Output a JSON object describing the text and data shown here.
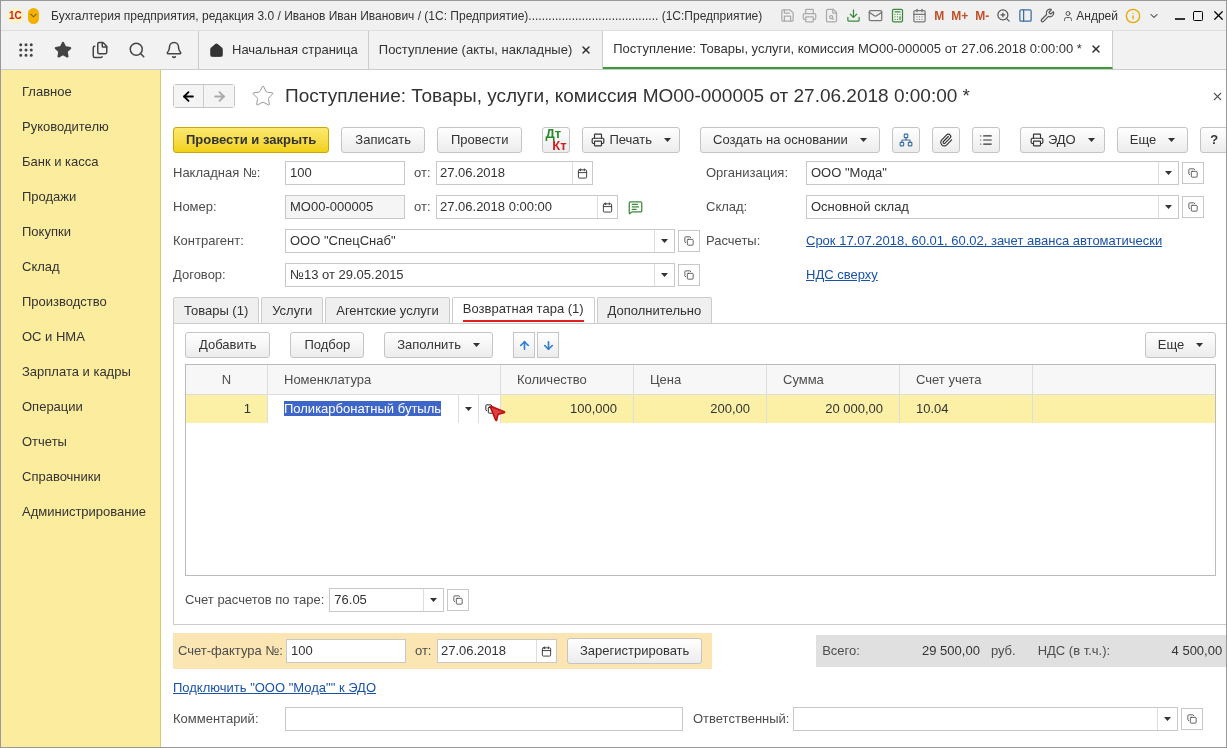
{
  "window": {
    "logo": "1С",
    "title": "Бухгалтерия предприятия, редакция 3.0 / Иванов Иван Иванович / (1С: Предприятие)....................................... (1С:Предприятие)",
    "memory_buttons": [
      "M",
      "M+",
      "M-"
    ],
    "user": "Андрей"
  },
  "tabs": [
    {
      "kind": "home",
      "label": "Начальная страница",
      "selected": false
    },
    {
      "kind": "doc",
      "label": "Поступление (акты, накладные)",
      "selected": false
    },
    {
      "kind": "doc",
      "label": "Поступление: Товары, услуги, комиссия МО00-000005 от 27.06.2018 0:00:00 *",
      "selected": true
    }
  ],
  "sidebar": {
    "items": [
      "Главное",
      "Руководителю",
      "Банк и касса",
      "Продажи",
      "Покупки",
      "Склад",
      "Производство",
      "ОС и НМА",
      "Зарплата и кадры",
      "Операции",
      "Отчеты",
      "Справочники",
      "Администрирование"
    ]
  },
  "form": {
    "title": "Поступление: Товары, услуги, комиссия МО00-000005 от 27.06.2018 0:00:00 *",
    "commands": [
      {
        "kind": "primary",
        "label": "Провести и закрыть"
      },
      {
        "kind": "plain",
        "label": "Записать"
      },
      {
        "kind": "plain",
        "label": "Провести"
      },
      {
        "kind": "dtkt",
        "label": "Дт",
        "label2": "Кт"
      },
      {
        "kind": "print",
        "label": "Печать"
      },
      {
        "kind": "menu",
        "label": "Создать на основании"
      },
      {
        "kind": "structure"
      },
      {
        "kind": "clip"
      },
      {
        "kind": "list"
      },
      {
        "kind": "edo",
        "label": "ЭДО"
      },
      {
        "kind": "menu",
        "label": "Еще"
      },
      {
        "kind": "help",
        "label": "?"
      }
    ],
    "invoice_no": {
      "label": "Накладная  №:",
      "value": "100",
      "date_label": "от:",
      "date": "27.06.2018"
    },
    "number": {
      "label": "Номер:",
      "value": "МО00-000005",
      "date_label": "от:",
      "date": "27.06.2018  0:00:00"
    },
    "counterparty": {
      "label": "Контрагент:",
      "value": "ООО \"СпецСнаб\""
    },
    "contract": {
      "label": "Договор:",
      "value": "№13 от 29.05.2015"
    },
    "organization": {
      "label": "Организация:",
      "value": "ООО \"Мода\""
    },
    "warehouse": {
      "label": "Склад:",
      "value": "Основной склад"
    },
    "settlements": {
      "label": "Расчеты:",
      "link": "Срок 17.07.2018, 60.01, 60.02, зачет аванса автоматически"
    },
    "vat_link": "НДС сверху",
    "sections": [
      {
        "label": "Товары (1)",
        "selected": false
      },
      {
        "label": "Услуги",
        "selected": false
      },
      {
        "label": "Агентские услуги",
        "selected": false
      },
      {
        "label": "Возвратная тара (1)",
        "selected": true
      },
      {
        "label": "Дополнительно",
        "selected": false
      }
    ],
    "table_commands": [
      {
        "kind": "plain",
        "label": "Добавить"
      },
      {
        "kind": "plain",
        "label": "Подбор"
      },
      {
        "kind": "menu",
        "label": "Заполнить"
      },
      {
        "kind": "up"
      },
      {
        "kind": "down"
      }
    ],
    "table_more": "Еще",
    "table": {
      "columns": [
        "N",
        "Номенклатура",
        "Количество",
        "Цена",
        "Сумма",
        "Счет учета"
      ],
      "rows": [
        {
          "selected": true,
          "cells": [
            "1",
            "Поликарбонатный бутыль",
            "100,000",
            "200,00",
            "20 000,00",
            "10.04"
          ]
        }
      ]
    },
    "container_account": {
      "label": "Счет расчетов по таре:",
      "value": "76.05"
    },
    "vat_invoice": {
      "label": "Счет-фактура №:",
      "value": "100",
      "date_label": "от:",
      "date": "27.06.2018",
      "button": "Зарегистрировать"
    },
    "totals": {
      "total_label": "Всего:",
      "total": "29 500,00",
      "currency": "руб.",
      "vat_label": "НДС (в т.ч.):",
      "vat": "4 500,00"
    },
    "edo_link": "Подключить \"ООО \"Мода\"\" к ЭДО",
    "comment": {
      "label": "Комментарий:"
    },
    "responsible": {
      "label": "Ответственный:"
    }
  }
}
